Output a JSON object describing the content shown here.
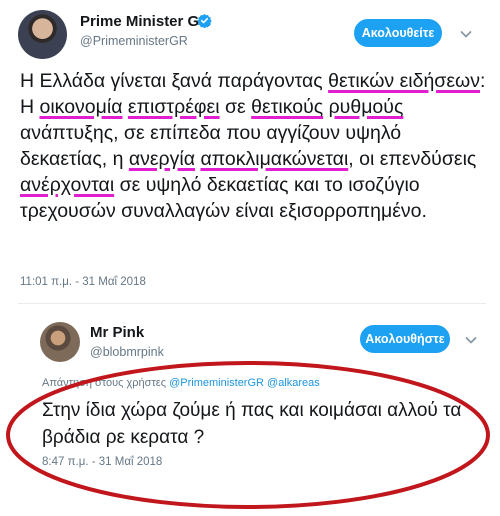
{
  "main_tweet": {
    "display_name": "Prime Minister GR",
    "handle": "@PrimeministerGR",
    "follow_label": "Ακολουθείτε",
    "text_segments": [
      {
        "text": "Η Ελλάδα γίνεται ξανά παράγοντας ",
        "highlight": false
      },
      {
        "text": "θετικών ειδήσεων",
        "highlight": true
      },
      {
        "text": ": Η ",
        "highlight": false
      },
      {
        "text": "οικονομία",
        "highlight": true
      },
      {
        "text": " ",
        "highlight": false
      },
      {
        "text": "επιστρέφει",
        "highlight": true
      },
      {
        "text": " σε ",
        "highlight": false
      },
      {
        "text": "θετικούς",
        "highlight": true
      },
      {
        "text": " ",
        "highlight": false
      },
      {
        "text": "ρυθμούς",
        "highlight": true
      },
      {
        "text": " ανάπτυξης, σε επίπεδα που αγγίζουν υψηλό δεκαετίας, η ",
        "highlight": false
      },
      {
        "text": "ανεργία",
        "highlight": true
      },
      {
        "text": " ",
        "highlight": false
      },
      {
        "text": "αποκλιμακώνεται",
        "highlight": true
      },
      {
        "text": ", οι επενδύσεις ",
        "highlight": false
      },
      {
        "text": "ανέρχονται",
        "highlight": true
      },
      {
        "text": " σε υψηλό δεκαετίας και το ισοζύγιο τρεχουσών συναλλαγών είναι εξισορροπημένο.",
        "highlight": false
      }
    ],
    "timestamp": "11:01 π.μ. - 31 Μαΐ 2018"
  },
  "reply_tweet": {
    "display_name": "Mr Pink",
    "handle": "@blobmrpink",
    "follow_label": "Ακολουθήστε",
    "reply_to_prefix": "Απάντηση στους χρήστες",
    "reply_to_users": "@PrimeministerGR @alkareas",
    "text": "Στην ίδια χώρα ζούμε ή πας και κοιμάσαι αλλού τα βράδια ρε κερατα ?",
    "timestamp": "8:47 π.μ. - 31 Μαΐ 2018"
  },
  "colors": {
    "accent": "#1da1f2",
    "highlight_underline": "#e020d0",
    "annotation_ellipse": "#c0161c",
    "secondary_text": "#657786"
  },
  "icons": [
    "verified-badge-icon",
    "chevron-down-icon"
  ]
}
